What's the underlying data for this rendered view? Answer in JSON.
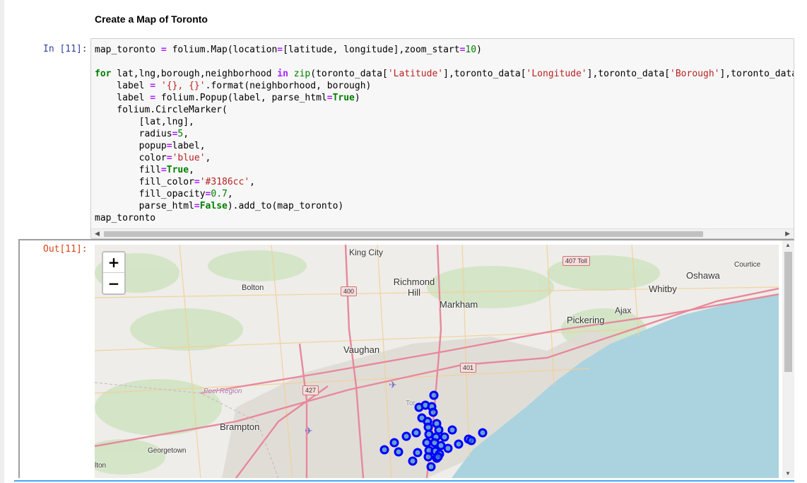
{
  "notebook": {
    "heading": "Create a Map of Toronto",
    "in_prompt": "In [11]:",
    "out_prompt": "Out[11]:"
  },
  "code": {
    "lines": [
      "map_toronto = folium.Map(location=[latitude, longitude],zoom_start=10)",
      "",
      "for lat,lng,borough,neighborhood in zip(toronto_data['Latitude'],toronto_data['Longitude'],toronto_data['Borough'],toronto_data['",
      "    label = '{}, {}'.format(neighborhood, borough)",
      "    label = folium.Popup(label, parse_html=True)",
      "    folium.CircleMarker(",
      "        [lat,lng],",
      "        radius=5,",
      "        popup=label,",
      "        color='blue',",
      "        fill=True,",
      "        fill_color='#3186cc',",
      "        fill_opacity=0.7,",
      "        parse_html=False).add_to(map_toronto)",
      "map_toronto"
    ]
  },
  "map": {
    "zoom_in": "+",
    "zoom_out": "−",
    "places": {
      "king_city": "King City",
      "bolton": "Bolton",
      "richmond_hill": "Richmond Hill",
      "markham": "Markham",
      "pickering": "Pickering",
      "ajax": "Ajax",
      "whitby": "Whitby",
      "oshawa": "Oshawa",
      "courtice": "Courtice",
      "vaughan": "Vaughan",
      "peel_region": "Peel Region",
      "brampton": "Brampton",
      "georgetown": "Georgetown",
      "milton_fragment": "lton",
      "toronto_fragment": "Tor"
    },
    "shields": {
      "hwy_407_toll": "407 Toll",
      "hwy_400": "400",
      "hwy_401": "401",
      "hwy_427": "427"
    },
    "colors": {
      "water": "#aad3df",
      "land": "#eeede9",
      "marker_stroke": "#0000ff",
      "marker_fill": "#3186cc",
      "major_road": "#e892a2",
      "minor_road": "#f9d6a0"
    }
  }
}
